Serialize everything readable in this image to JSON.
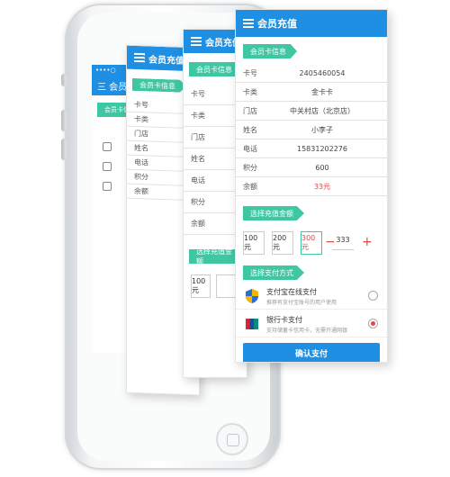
{
  "app": {
    "title": "会员充值",
    "title_small": "会员充值"
  },
  "phone_screen": {
    "status": "••••○",
    "title": "三 会员充值",
    "section": "会员卡信息"
  },
  "card1": {
    "section": "会员卡信息",
    "labels": [
      "卡号",
      "卡类",
      "门店",
      "姓名",
      "电话",
      "积分",
      "余额"
    ]
  },
  "card2": {
    "section": "会员卡信息",
    "labels": [
      "卡号",
      "卡类",
      "门店",
      "姓名",
      "电话",
      "积分",
      "余额"
    ],
    "amount_section": "选择充值金额",
    "amount_first": "100元"
  },
  "card3": {
    "section_info": "会员卡信息",
    "rows": [
      {
        "label": "卡号",
        "value": "2405460054"
      },
      {
        "label": "卡类",
        "value": "金卡卡"
      },
      {
        "label": "门店",
        "value": "中关村店（北京店）"
      },
      {
        "label": "姓名",
        "value": "小李子"
      },
      {
        "label": "电话",
        "value": "15831202276"
      },
      {
        "label": "积分",
        "value": "600"
      },
      {
        "label": "余额",
        "value": "33元"
      }
    ],
    "section_amount": "选择充值金额",
    "amounts": [
      "100元",
      "200元",
      "300元"
    ],
    "stepper": {
      "minus": "−",
      "value": "333",
      "plus": "+"
    },
    "section_pay": "选择支付方式",
    "pay_methods": [
      {
        "title": "支付宝在线支付",
        "desc": "推荐有支付宝账号的用户使用"
      },
      {
        "title": "银行卡支付",
        "desc": "支持储蓄卡信用卡，无需开通网银"
      }
    ],
    "confirm": "确认支付"
  },
  "colors": {
    "blue": "#1e8fe3",
    "green": "#3fc6a3",
    "red": "#e04848"
  }
}
